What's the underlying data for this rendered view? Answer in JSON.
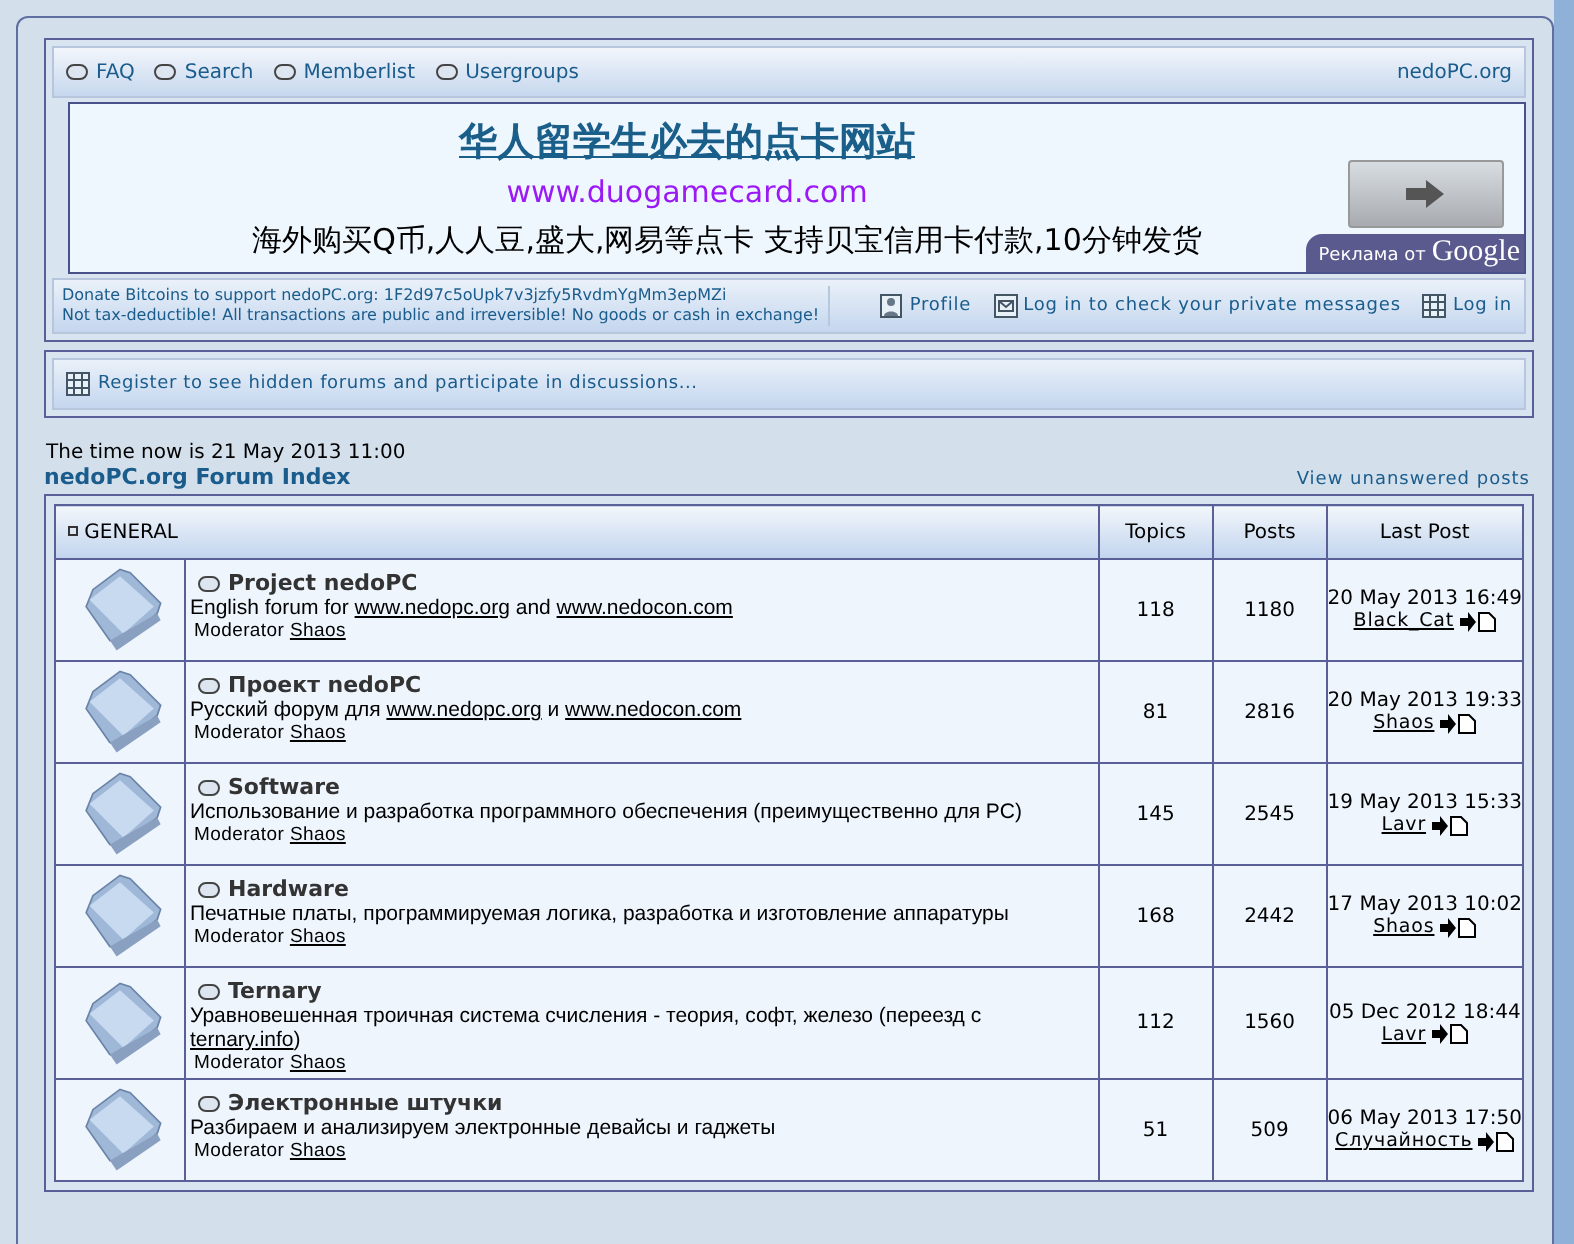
{
  "nav": {
    "links": [
      {
        "label": "FAQ"
      },
      {
        "label": "Search"
      },
      {
        "label": "Memberlist"
      },
      {
        "label": "Usergroups"
      }
    ],
    "site": "nedoPC.org"
  },
  "ad": {
    "title": "华人留学生必去的点卡网站",
    "url": "www.duogamecard.com",
    "text": "海外购买Q币,人人豆,盛大,网易等点卡 支持贝宝信用卡付款,10分钟发货",
    "badge_prefix": "Реклама от",
    "badge_brand": "Google"
  },
  "donate": [
    "Donate Bitcoins to support nedoPC.org: 1F2d97c5oUpk7v3jzfy5RvdmYgMm3epMZi",
    "Not tax-deductible! All transactions are public and irreversible! No goods or cash in exchange!"
  ],
  "user_links": [
    {
      "kind": "profile",
      "label": "Profile"
    },
    {
      "kind": "messages",
      "label": "Log in to check your private messages"
    },
    {
      "kind": "login",
      "label": "Log in"
    }
  ],
  "register": "Register to see hidden forums and participate in discussions...",
  "time": "The time now is 21 May 2013 11:00",
  "index_link": "nedoPC.org Forum Index",
  "unanswered_link": "View unanswered posts",
  "table": {
    "category": "GENERAL",
    "columns": [
      "Topics",
      "Posts",
      "Last Post"
    ],
    "rows": [
      {
        "title": "Project nedoPC",
        "description": [
          {
            "kind": "text",
            "text": "English forum for "
          },
          {
            "kind": "link",
            "text": "www.nedopc.org"
          },
          {
            "kind": "text",
            "text": " and "
          },
          {
            "kind": "link",
            "text": "www.nedocon.com"
          }
        ],
        "moderator_label": "Moderator",
        "moderator": "Shaos",
        "topics": "118",
        "posts": "1180",
        "last_date": "20 May 2013 16:49",
        "last_user": "Black_Cat"
      },
      {
        "title": "Проект nedoPC",
        "description": [
          {
            "kind": "text",
            "text": "Русский форум для "
          },
          {
            "kind": "link",
            "text": "www.nedopc.org"
          },
          {
            "kind": "text",
            "text": " и "
          },
          {
            "kind": "link",
            "text": "www.nedocon.com"
          }
        ],
        "moderator_label": "Moderator",
        "moderator": "Shaos",
        "topics": "81",
        "posts": "2816",
        "last_date": "20 May 2013 19:33",
        "last_user": "Shaos"
      },
      {
        "title": "Software",
        "description": [
          {
            "kind": "text",
            "text": "Использование и разработка программного обеспечения (преимущественно для PC)"
          }
        ],
        "moderator_label": "Moderator",
        "moderator": "Shaos",
        "topics": "145",
        "posts": "2545",
        "last_date": "19 May 2013 15:33",
        "last_user": "Lavr"
      },
      {
        "title": "Hardware",
        "description": [
          {
            "kind": "text",
            "text": "Печатные платы, программируемая логика, разработка и изготовление аппаратуры"
          }
        ],
        "moderator_label": "Moderator",
        "moderator": "Shaos",
        "topics": "168",
        "posts": "2442",
        "last_date": "17 May 2013 10:02",
        "last_user": "Shaos"
      },
      {
        "title": "Ternary",
        "description": [
          {
            "kind": "text",
            "text": "Уравновешенная троичная система счисления - теория, софт, железо (переезд с "
          },
          {
            "kind": "link",
            "text": "ternary.info"
          },
          {
            "kind": "text",
            "text": ")"
          }
        ],
        "moderator_label": "Moderator",
        "moderator": "Shaos",
        "topics": "112",
        "posts": "1560",
        "last_date": "05 Dec 2012 18:44",
        "last_user": "Lavr"
      },
      {
        "title": "Электронные штучки",
        "description": [
          {
            "kind": "text",
            "text": "Разбираем и анализируем электронные девайсы и гаджеты"
          }
        ],
        "moderator_label": "Moderator",
        "moderator": "Shaos",
        "topics": "51",
        "posts": "509",
        "last_date": "06 May 2013 17:50",
        "last_user": "Случайность"
      }
    ]
  }
}
